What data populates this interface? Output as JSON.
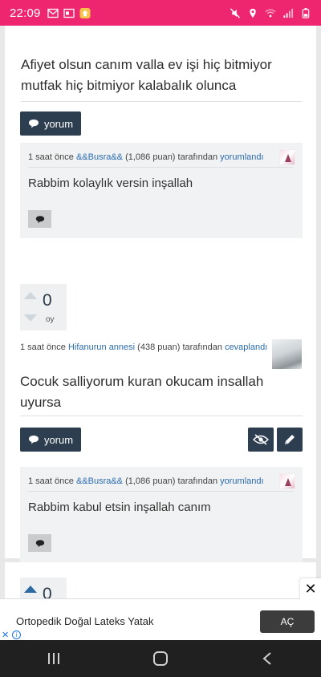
{
  "status_bar": {
    "time": "22:09",
    "left_icons": [
      "mail-icon",
      "gallery-icon",
      "app-icon"
    ],
    "right_icons": [
      "mute-icon",
      "location-icon",
      "wifi-icon",
      "signal-icon",
      "battery-icon"
    ],
    "background_color": "#ee2670"
  },
  "answers": [
    {
      "text": "Afiyet olsun canım valla ev işi hiç bitmiyor mutfak hiç bitmiyor kalabalık olunca",
      "comment_button_label": "yorum",
      "comment": {
        "time": "1 saat önce",
        "author": "&&Busra&&",
        "points": "(1,086 puan)",
        "by": "tarafından",
        "action": "yorumlandı",
        "text": "Rabbim kolaylık versin inşallah"
      }
    },
    {
      "vote_count": "0",
      "vote_label": "oy",
      "meta": {
        "time": "1 saat önce",
        "author": "Hifanurun annesi",
        "points": "(438 puan)",
        "by": "tarafından",
        "action": "cevaplandı"
      },
      "text": "Cocuk salliyorum kuran okucam insallah uyursa",
      "comment_button_label": "yorum",
      "comment": {
        "time": "1 saat önce",
        "author": "&&Busra&&",
        "points": "(1,086 puan)",
        "by": "tarafından",
        "action": "yorumlandı",
        "text": "Rabbim kabul etsin inşallah canım"
      }
    },
    {
      "vote_count": "0"
    }
  ],
  "ad": {
    "text": "Ortopedik Doğal Lateks Yatak",
    "cta": "AÇ",
    "close": "✕"
  },
  "colors": {
    "accent_dark": "#2c3e50",
    "link": "#2b6cb0"
  }
}
